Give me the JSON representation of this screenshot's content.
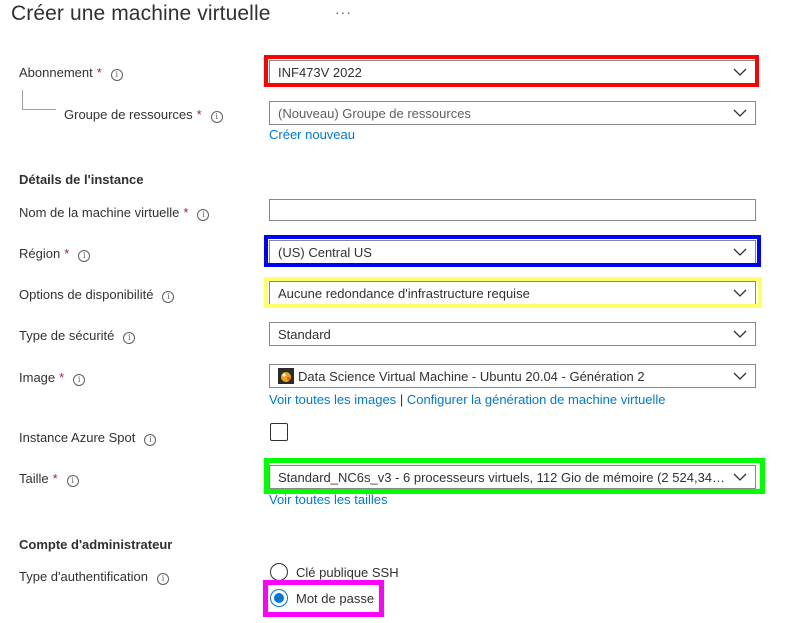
{
  "header": {
    "title": "Créer une machine virtuelle",
    "more": "···"
  },
  "fields": {
    "subscription": {
      "label": "Abonnement",
      "required": "*",
      "value": "INF473V 2022"
    },
    "resource_group": {
      "label": "Groupe de ressources",
      "required": "*",
      "placeholder": "(Nouveau) Groupe de ressources",
      "create_link": "Créer nouveau"
    },
    "instance_section": "Détails de l'instance",
    "vm_name": {
      "label": "Nom de la machine virtuelle",
      "required": "*",
      "value": ""
    },
    "region": {
      "label": "Région",
      "required": "*",
      "value": "(US) Central US"
    },
    "availability": {
      "label": "Options de disponibilité",
      "value": "Aucune redondance d'infrastructure requise"
    },
    "security_type": {
      "label": "Type de sécurité",
      "value": "Standard"
    },
    "image": {
      "label": "Image",
      "required": "*",
      "value": "Data Science Virtual Machine - Ubuntu 20.04 - Génération 2",
      "link_all": "Voir toutes les images",
      "link_sep": "|",
      "link_config": "Configurer la génération de machine virtuelle"
    },
    "spot": {
      "label": "Instance Azure Spot",
      "checked": false
    },
    "size": {
      "label": "Taille",
      "required": "*",
      "value": "Standard_NC6s_v3 - 6 processeurs virtuels, 112 Gio de mémoire (2 524,34 $…",
      "link_all": "Voir toutes les tailles"
    },
    "admin_section": "Compte d'administrateur",
    "auth_type": {
      "label": "Type d'authentification",
      "options": [
        "Clé publique SSH",
        "Mot de passe"
      ],
      "selected": "Mot de passe"
    }
  },
  "info_glyph": "i",
  "highlight_colors": {
    "subscription": "#ff0000",
    "region": "#0000ff",
    "availability": "#ffff66",
    "size": "#00ff00",
    "password": "#ff00ff"
  },
  "icons": {
    "chevron": "chevron-down-icon",
    "info": "info-icon",
    "image": "ubuntu-dsvm-icon"
  }
}
